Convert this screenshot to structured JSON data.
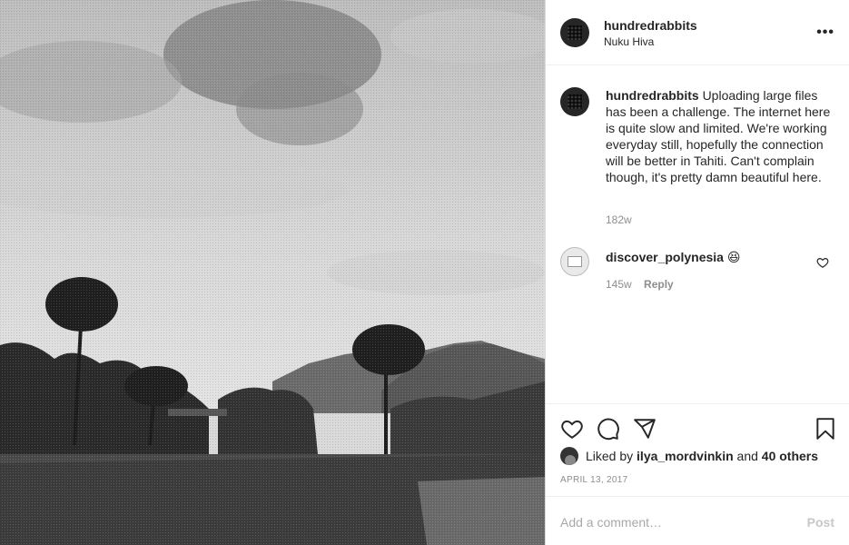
{
  "post": {
    "username": "hundredrabbits",
    "location": "Nuku Hiva",
    "more_icon": "more-options-icon",
    "more_glyph": "•••"
  },
  "caption": {
    "username": "hundredrabbits",
    "text": "Uploading large files has been a challenge. The internet here is quite slow and limited. We're working everyday still, hopefully the connection will be better in Tahiti. Can't complain though, it's pretty damn beautiful here.",
    "time": "182w"
  },
  "comment": {
    "username": "discover_polynesia",
    "text": "😆",
    "time": "145w",
    "reply_label": "Reply"
  },
  "actions": {
    "icons": [
      "heart-icon",
      "comment-icon",
      "share-icon",
      "bookmark-icon"
    ]
  },
  "likes": {
    "prefix": "Liked by",
    "user": "ilya_mordvinkin",
    "and": "and",
    "others": "40 others"
  },
  "date": "APRIL 13, 2017",
  "add_comment": {
    "placeholder": "Add a comment…",
    "post_label": "Post"
  },
  "colors": {
    "text": "#262626",
    "secondary": "#8e8e8e",
    "border": "#dbdbdb"
  }
}
